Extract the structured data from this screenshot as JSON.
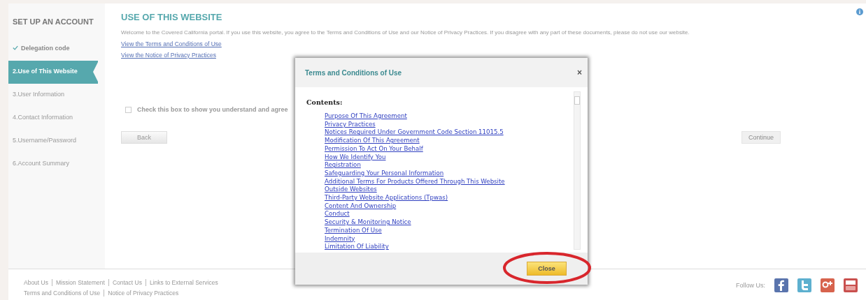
{
  "sidebar": {
    "title": "SET UP AN ACCOUNT",
    "steps": [
      {
        "label": "Delegation code",
        "kind": "done",
        "selected": false
      },
      {
        "label": "2.Use of This Website",
        "kind": "current",
        "selected": true
      },
      {
        "label": "3.User Information",
        "kind": "todo",
        "selected": false
      },
      {
        "label": "4.Contact Information",
        "kind": "todo",
        "selected": false
      },
      {
        "label": "5.Username/Password",
        "kind": "todo",
        "selected": false
      },
      {
        "label": "6.Account Summary",
        "kind": "todo",
        "selected": false
      }
    ]
  },
  "main": {
    "title": "USE OF THIS WEBSITE",
    "intro": "Welcome to the Covered California portal. If you use this website, you agree to the Terms and Conditions of Use and our Notice of Privacy Practices. If you disagree with any part of these documents, please do not use our website.",
    "links": [
      "View the Terms and Conditions of Use",
      "View the Notice of Privacy Practices"
    ],
    "agree": {
      "label": "Check this box to show you understand and agree",
      "checked": false
    },
    "back_button": "Back",
    "continue_button": {
      "label": "Continue",
      "disabled": true
    }
  },
  "dialog": {
    "title": "Terms and Conditions of Use",
    "close_icon": "×",
    "contents_heading": "Contents:",
    "contents": [
      "Purpose Of This Agreement",
      "Privacy Practices",
      "Notices Required Under Government Code Section 11015.5",
      "Modification Of This Agreement",
      "Permission To Act On Your Behalf",
      "How We Identify You",
      "Registration",
      "Safeguarding Your Personal Information",
      "Additional Terms For Products Offered Through This Website",
      "Outside Websites",
      "Third-Party Website Applications (Tpwas)",
      "Content And Ownership",
      "Conduct",
      "Security & Monitoring Notice",
      "Termination Of Use",
      "Indemnity",
      "Limitation Of Liability"
    ],
    "close_button": "Close"
  },
  "footer": {
    "links_row1": [
      "About Us",
      "Mission Statement",
      "Contact Us",
      "Links to External Services"
    ],
    "links_row2": [
      "Terms and Conditions of Use",
      "Notice of Privacy Practices"
    ],
    "follow": "Follow Us:"
  }
}
